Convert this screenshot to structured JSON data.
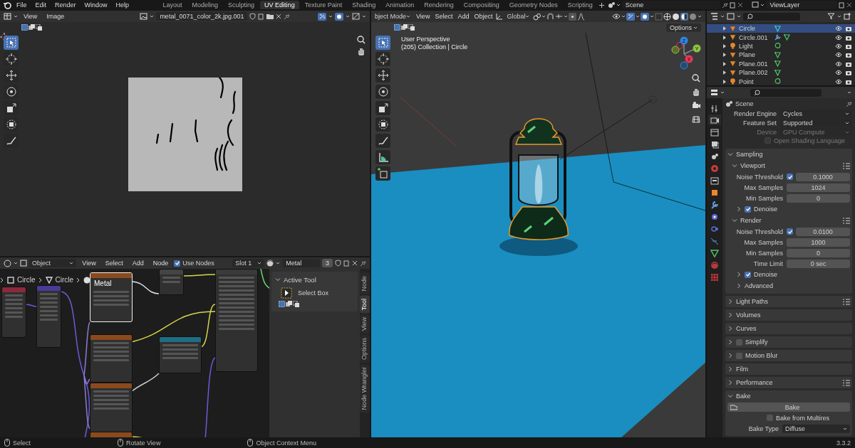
{
  "top_bar": {
    "menus": [
      "File",
      "Edit",
      "Render",
      "Window",
      "Help"
    ],
    "workspaces": [
      {
        "label": "Layout",
        "selected": false
      },
      {
        "label": "Modeling",
        "selected": false
      },
      {
        "label": "Sculpting",
        "selected": false
      },
      {
        "label": "UV Editing",
        "selected": true
      },
      {
        "label": "Texture Paint",
        "selected": false
      },
      {
        "label": "Shading",
        "selected": false
      },
      {
        "label": "Animation",
        "selected": false
      },
      {
        "label": "Rendering",
        "selected": false
      },
      {
        "label": "Compositing",
        "selected": false
      },
      {
        "label": "Geometry Nodes",
        "selected": false
      },
      {
        "label": "Scripting",
        "selected": false
      }
    ],
    "scene": "Scene",
    "view_layer": "ViewLayer"
  },
  "uv_editor": {
    "menus": [
      "View",
      "Image"
    ],
    "image_name": "metal_0071_color_2k.jpg.001"
  },
  "viewport_3d": {
    "mode": "bject Mode",
    "menus": [
      "View",
      "Select",
      "Add",
      "Object"
    ],
    "orientation": "Global",
    "options": "Options",
    "overlay_lines": [
      "User Perspective",
      "(205) Collection | Circle"
    ],
    "gizmo_axes": [
      "Z",
      "Y",
      "X"
    ]
  },
  "node_editor": {
    "object_type": "Object",
    "menus": [
      "View",
      "Select",
      "Add",
      "Node"
    ],
    "use_nodes": {
      "label": "Use Nodes",
      "checked": true
    },
    "slot": "Slot 1",
    "material": "Metal",
    "user_count": "3",
    "breadcrumbs": [
      "Circle",
      "Circle"
    ],
    "node_title": "Metal",
    "sidebar": {
      "panel": "Active Tool",
      "tool": "Select Box"
    },
    "tabs": [
      {
        "label": "Node",
        "selected": false
      },
      {
        "label": "Tool",
        "selected": true
      },
      {
        "label": "View",
        "selected": false
      },
      {
        "label": "Options",
        "selected": false
      },
      {
        "label": "Node Wrangler",
        "selected": false
      }
    ]
  },
  "outliner": {
    "items": [
      {
        "name": "Circle",
        "kind": "mesh",
        "selected": true,
        "modifier": false
      },
      {
        "name": "Circle.001",
        "kind": "mesh",
        "selected": false,
        "modifier": true
      },
      {
        "name": "Light",
        "kind": "light",
        "selected": false,
        "modifier": false
      },
      {
        "name": "Plane",
        "kind": "mesh",
        "selected": false,
        "modifier": false
      },
      {
        "name": "Plane.001",
        "kind": "mesh",
        "selected": false,
        "modifier": false
      },
      {
        "name": "Plane.002",
        "kind": "mesh",
        "selected": false,
        "modifier": false
      },
      {
        "name": "Point",
        "kind": "light",
        "selected": false,
        "modifier": false
      }
    ]
  },
  "properties": {
    "context": "Scene",
    "tabs": [
      {
        "kind": "tool",
        "selected": false
      },
      {
        "kind": "render",
        "selected": true
      },
      {
        "kind": "output",
        "selected": false
      },
      {
        "kind": "view_layer",
        "selected": false
      },
      {
        "kind": "scene",
        "selected": false
      },
      {
        "kind": "world",
        "selected": false
      },
      {
        "kind": "collection",
        "selected": false
      },
      {
        "kind": "object",
        "selected": false
      },
      {
        "kind": "modifier",
        "selected": false
      },
      {
        "kind": "particles",
        "selected": false
      },
      {
        "kind": "physics",
        "selected": false
      },
      {
        "kind": "constraints",
        "selected": false
      },
      {
        "kind": "data",
        "selected": false
      },
      {
        "kind": "material",
        "selected": false
      },
      {
        "kind": "texture",
        "selected": false
      }
    ],
    "fields": [
      {
        "kind": "dropdown",
        "label": "Render Engine",
        "value": "Cycles",
        "disabled": false
      },
      {
        "kind": "dropdown",
        "label": "Feature Set",
        "value": "Supported",
        "disabled": false
      },
      {
        "kind": "dropdown",
        "label": "Device",
        "value": "GPU Compute",
        "disabled": true
      },
      {
        "kind": "checkbox",
        "label": "Open Shading Language",
        "checked": false,
        "disabled": true
      }
    ],
    "panels": [
      {
        "title": "Sampling",
        "expanded": true,
        "children": [
          {
            "kind": "subpanel",
            "title": "Viewport",
            "expanded": true,
            "preset": true,
            "children": [
              {
                "kind": "number",
                "label": "Noise Threshold",
                "checked": true,
                "value": "0.1000"
              },
              {
                "kind": "number",
                "label": "Max Samples",
                "value": "1024"
              },
              {
                "kind": "number",
                "label": "Min Samples",
                "value": "0"
              },
              {
                "kind": "subpanel",
                "title": "Denoise",
                "expanded": false,
                "checked": true
              }
            ]
          },
          {
            "kind": "subpanel",
            "title": "Render",
            "expanded": true,
            "preset": true,
            "children": [
              {
                "kind": "number",
                "label": "Noise Threshold",
                "checked": true,
                "value": "0.0100"
              },
              {
                "kind": "number",
                "label": "Max Samples",
                "value": "1000"
              },
              {
                "kind": "number",
                "label": "Min Samples",
                "value": "0"
              },
              {
                "kind": "number",
                "label": "Time Limit",
                "value": "0 sec"
              },
              {
                "kind": "subpanel",
                "title": "Denoise",
                "expanded": false,
                "checked": true
              },
              {
                "kind": "subpanel",
                "title": "Advanced",
                "expanded": false
              }
            ]
          }
        ]
      },
      {
        "title": "Light Paths",
        "expanded": false,
        "preset": true
      },
      {
        "title": "Volumes",
        "expanded": false
      },
      {
        "title": "Curves",
        "expanded": false
      },
      {
        "title": "Simplify",
        "expanded": false,
        "checked": false
      },
      {
        "title": "Motion Blur",
        "expanded": false,
        "checked": false
      },
      {
        "title": "Film",
        "expanded": false
      },
      {
        "title": "Performance",
        "expanded": false,
        "preset": true
      },
      {
        "title": "Bake",
        "expanded": true,
        "children": [
          {
            "kind": "button",
            "label": "Bake"
          },
          {
            "kind": "checkbox",
            "label": "Bake from Multires",
            "checked": false,
            "disabled": false
          },
          {
            "kind": "dropdown",
            "label": "Bake Type",
            "value": "Diffuse",
            "disabled": false
          }
        ]
      }
    ]
  },
  "status_bar": {
    "hints": [
      "Select",
      "Rotate View",
      "Object Context Menu"
    ],
    "version": "3.3.2"
  }
}
